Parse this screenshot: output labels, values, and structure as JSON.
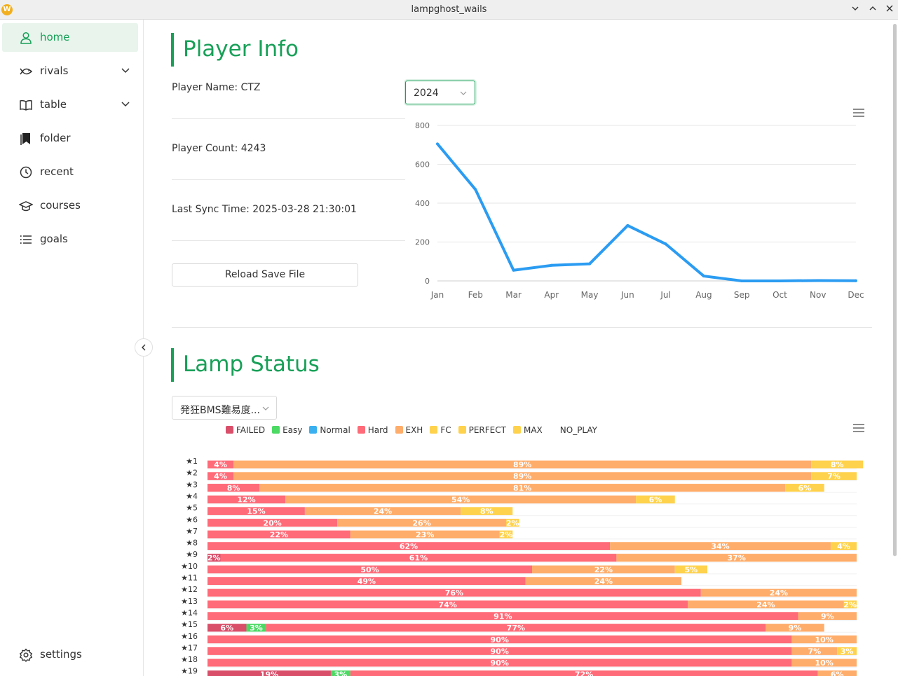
{
  "window": {
    "title": "lampghost_wails",
    "app_icon_letter": "W"
  },
  "sidebar": {
    "items": [
      {
        "label": "home",
        "icon": "user-icon",
        "active": true
      },
      {
        "label": "rivals",
        "icon": "fish-icon",
        "expandable": true
      },
      {
        "label": "table",
        "icon": "book-icon",
        "expandable": true
      },
      {
        "label": "folder",
        "icon": "bookmark-icon"
      },
      {
        "label": "recent",
        "icon": "clock-icon"
      },
      {
        "label": "courses",
        "icon": "graduation-cap-icon"
      },
      {
        "label": "goals",
        "icon": "list-icon"
      }
    ],
    "settings_label": "settings"
  },
  "player_info": {
    "title": "Player Info",
    "name_line": "Player Name: CTZ",
    "count_line": "Player Count: 4243",
    "sync_line": "Last Sync Time: 2025-03-28 21:30:01",
    "reload_label": "Reload Save File",
    "year_selected": "2024"
  },
  "lamp_status": {
    "title": "Lamp Status",
    "table_selected": "発狂BMS難易度..."
  },
  "chart_data": [
    {
      "type": "line",
      "categories": [
        "Jan",
        "Feb",
        "Mar",
        "Apr",
        "May",
        "Jun",
        "Jul",
        "Aug",
        "Sep",
        "Oct",
        "Nov",
        "Dec"
      ],
      "values": [
        705,
        470,
        55,
        80,
        88,
        285,
        190,
        25,
        0,
        0,
        2,
        1
      ],
      "ylim": [
        0,
        800
      ],
      "yticks": [
        0,
        200,
        400,
        600,
        800
      ],
      "grid": true,
      "color": "#2b9cf2"
    },
    {
      "type": "bar",
      "stacked": "horizontal",
      "legend": [
        {
          "name": "FAILED",
          "color": "#d94f6a"
        },
        {
          "name": "Easy",
          "color": "#4cd964"
        },
        {
          "name": "Normal",
          "color": "#3ab0f0"
        },
        {
          "name": "Hard",
          "color": "#ff6b78"
        },
        {
          "name": "EXH",
          "color": "#ffad6b"
        },
        {
          "name": "FC",
          "color": "#ffd24d"
        },
        {
          "name": "PERFECT",
          "color": "#ffd24d"
        },
        {
          "name": "MAX",
          "color": "#ffd24d"
        },
        {
          "name": "NO_PLAY",
          "color": ""
        }
      ],
      "categories": [
        "★1",
        "★2",
        "★3",
        "★4",
        "★5",
        "★6",
        "★7",
        "★8",
        "★9",
        "★10",
        "★11",
        "★12",
        "★13",
        "★14",
        "★15",
        "★16",
        "★17",
        "★18",
        "★19"
      ],
      "rows": [
        [
          {
            "lamp": "Hard",
            "pct": 4
          },
          {
            "lamp": "EXH",
            "pct": 89
          },
          {
            "lamp": "FC",
            "pct": 8
          }
        ],
        [
          {
            "lamp": "Hard",
            "pct": 4
          },
          {
            "lamp": "EXH",
            "pct": 89
          },
          {
            "lamp": "FC",
            "pct": 7
          }
        ],
        [
          {
            "lamp": "Hard",
            "pct": 8
          },
          {
            "lamp": "EXH",
            "pct": 81
          },
          {
            "lamp": "FC",
            "pct": 6
          }
        ],
        [
          {
            "lamp": "Hard",
            "pct": 12
          },
          {
            "lamp": "EXH",
            "pct": 54
          },
          {
            "lamp": "FC",
            "pct": 6
          }
        ],
        [
          {
            "lamp": "Hard",
            "pct": 15
          },
          {
            "lamp": "EXH",
            "pct": 24
          },
          {
            "lamp": "FC",
            "pct": 8
          }
        ],
        [
          {
            "lamp": "Hard",
            "pct": 20
          },
          {
            "lamp": "EXH",
            "pct": 26
          },
          {
            "lamp": "FC",
            "pct": 2
          }
        ],
        [
          {
            "lamp": "Hard",
            "pct": 22
          },
          {
            "lamp": "EXH",
            "pct": 23
          },
          {
            "lamp": "FC",
            "pct": 2
          }
        ],
        [
          {
            "lamp": "Hard",
            "pct": 62
          },
          {
            "lamp": "EXH",
            "pct": 34
          },
          {
            "lamp": "FC",
            "pct": 4
          }
        ],
        [
          {
            "lamp": "FAILED",
            "pct": 2
          },
          {
            "lamp": "Hard",
            "pct": 61
          },
          {
            "lamp": "EXH",
            "pct": 37
          }
        ],
        [
          {
            "lamp": "Hard",
            "pct": 50
          },
          {
            "lamp": "EXH",
            "pct": 22
          },
          {
            "lamp": "FC",
            "pct": 5
          }
        ],
        [
          {
            "lamp": "Hard",
            "pct": 49
          },
          {
            "lamp": "EXH",
            "pct": 24
          }
        ],
        [
          {
            "lamp": "Hard",
            "pct": 76
          },
          {
            "lamp": "EXH",
            "pct": 24
          }
        ],
        [
          {
            "lamp": "Hard",
            "pct": 74
          },
          {
            "lamp": "EXH",
            "pct": 24
          },
          {
            "lamp": "FC",
            "pct": 2
          }
        ],
        [
          {
            "lamp": "Hard",
            "pct": 91
          },
          {
            "lamp": "EXH",
            "pct": 9
          }
        ],
        [
          {
            "lamp": "FAILED",
            "pct": 6
          },
          {
            "lamp": "Easy",
            "pct": 3
          },
          {
            "lamp": "Hard",
            "pct": 77
          },
          {
            "lamp": "EXH",
            "pct": 9
          }
        ],
        [
          {
            "lamp": "Hard",
            "pct": 90
          },
          {
            "lamp": "EXH",
            "pct": 10
          }
        ],
        [
          {
            "lamp": "Hard",
            "pct": 90
          },
          {
            "lamp": "EXH",
            "pct": 7
          },
          {
            "lamp": "FC",
            "pct": 3
          }
        ],
        [
          {
            "lamp": "Hard",
            "pct": 90
          },
          {
            "lamp": "EXH",
            "pct": 10
          }
        ],
        [
          {
            "lamp": "FAILED",
            "pct": 19
          },
          {
            "lamp": "Easy",
            "pct": 3
          },
          {
            "lamp": "Hard",
            "pct": 72
          },
          {
            "lamp": "EXH",
            "pct": 6
          }
        ]
      ]
    }
  ]
}
